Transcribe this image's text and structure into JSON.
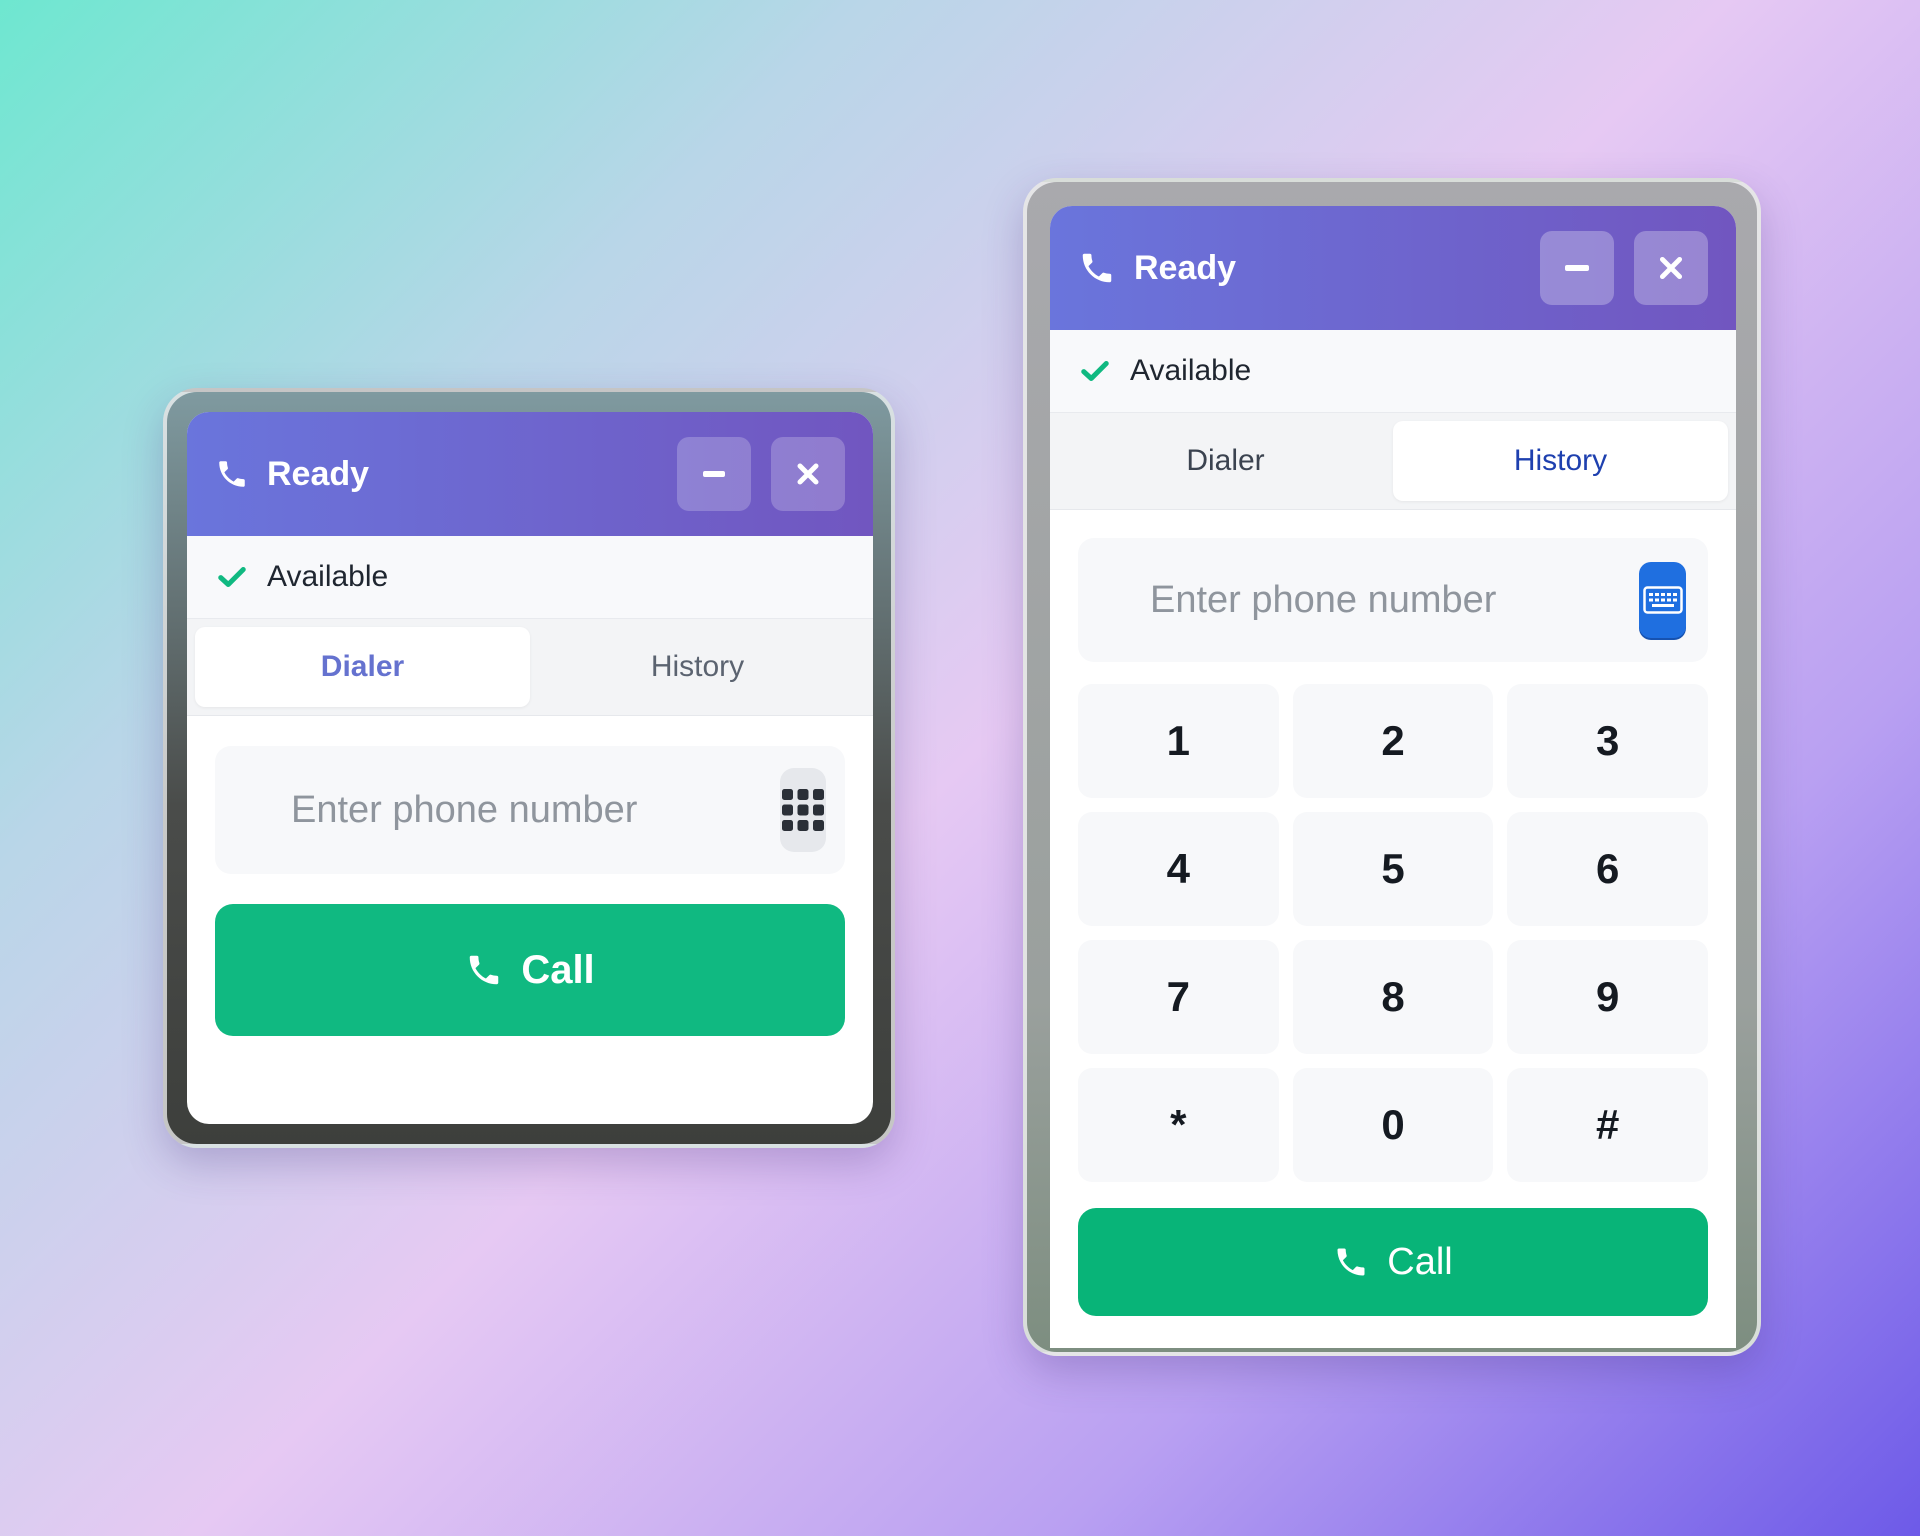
{
  "widgets": [
    {
      "title": "Ready",
      "status": "Available",
      "tabs": [
        "Dialer",
        "History"
      ],
      "active_tab": "Dialer",
      "phone_placeholder": "Enter phone number",
      "call_label": "Call",
      "icons": {
        "title": "phone-icon",
        "minimize": "minus-icon",
        "close": "close-icon",
        "status": "check-icon",
        "keypad": "grid-icon",
        "call": "phone-icon"
      }
    },
    {
      "title": "Ready",
      "status": "Available",
      "tabs": [
        "Dialer",
        "History"
      ],
      "active_tab": "History",
      "phone_placeholder": "Enter phone number",
      "keys": [
        "1",
        "2",
        "3",
        "4",
        "5",
        "6",
        "7",
        "8",
        "9",
        "*",
        "0",
        "#"
      ],
      "call_label": "Call",
      "icons": {
        "title": "phone-icon",
        "minimize": "minus-icon",
        "close": "close-icon",
        "status": "check-icon",
        "keypad": "keyboard-icon",
        "call": "phone-icon"
      }
    }
  ],
  "colors": {
    "header_start": "#6a75dc",
    "header_end": "#7156c0",
    "status_check": "#10b981",
    "call_button": "#10b981",
    "active_tab_a": "#6572cf",
    "active_tab_b": "#1e40af",
    "keyboard_button": "#1f6fe0"
  }
}
